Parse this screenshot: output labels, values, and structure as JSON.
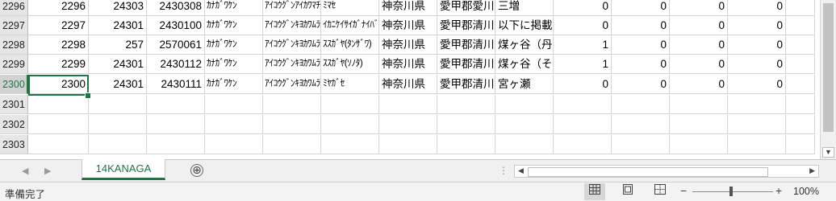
{
  "columns": [
    "",
    "",
    "",
    "",
    "",
    "",
    "",
    "",
    "",
    "",
    "",
    "",
    "",
    ""
  ],
  "rows": [
    {
      "row_num": "2296",
      "cells": [
        "2296",
        "24303",
        "2430308",
        "ｶﾅｶﾞﾜｹﾝ",
        "ｱｲｺｳｸﾞﾝｱｲｶﾜﾏﾁ",
        "ﾐﾏｾ",
        "神奈川県",
        "愛甲郡愛川町",
        "三増",
        "0",
        "0",
        "0",
        "0",
        ""
      ]
    },
    {
      "row_num": "2297",
      "cells": [
        "2297",
        "24301",
        "2430100",
        "ｶﾅｶﾞﾜｹﾝ",
        "ｱｲｺｳｸﾞﾝｷﾖｶﾜﾑﾗ",
        "ｲｶﾆｹｲｻｲｶﾞﾅｲﾊﾞｱｲ",
        "神奈川県",
        "愛甲郡清川村",
        "以下に掲載がない場合",
        "0",
        "0",
        "0",
        "0",
        ""
      ]
    },
    {
      "row_num": "2298",
      "cells": [
        "2298",
        "257",
        "2570061",
        "ｶﾅｶﾞﾜｹﾝ",
        "ｱｲｺｳｸﾞﾝｷﾖｶﾜﾑﾗ",
        "ｽｽｶﾞﾔ(ﾀﾝｻﾞﾜ)",
        "神奈川県",
        "愛甲郡清川村",
        "煤ヶ谷（丹沢）",
        "1",
        "0",
        "0",
        "0",
        ""
      ]
    },
    {
      "row_num": "2299",
      "cells": [
        "2299",
        "24301",
        "2430112",
        "ｶﾅｶﾞﾜｹﾝ",
        "ｱｲｺｳｸﾞﾝｷﾖｶﾜﾑﾗ",
        "ｽｽｶﾞﾔ(ｿﾉﾀ)",
        "神奈川県",
        "愛甲郡清川村",
        "煤ヶ谷（その他）",
        "1",
        "0",
        "0",
        "0",
        ""
      ]
    },
    {
      "row_num": "2300",
      "cells": [
        "2300",
        "24301",
        "2430111",
        "ｶﾅｶﾞﾜｹﾝ",
        "ｱｲｺｳｸﾞﾝｷﾖｶﾜﾑﾗ",
        "ﾐﾔｶﾞｾ",
        "神奈川県",
        "愛甲郡清川村",
        "宮ヶ瀬",
        "0",
        "0",
        "0",
        "0",
        ""
      ]
    },
    {
      "row_num": "2301",
      "cells": [
        "",
        "",
        "",
        "",
        "",
        "",
        "",
        "",
        "",
        "",
        "",
        "",
        "",
        ""
      ]
    },
    {
      "row_num": "2302",
      "cells": [
        "",
        "",
        "",
        "",
        "",
        "",
        "",
        "",
        "",
        "",
        "",
        "",
        "",
        ""
      ]
    },
    {
      "row_num": "2303",
      "cells": [
        "",
        "",
        "",
        "",
        "",
        "",
        "",
        "",
        "",
        "",
        "",
        "",
        "",
        ""
      ]
    }
  ],
  "sheet": {
    "tab_name": "14KANAGA",
    "add_symbol": "⊕",
    "nav_prev": "◀",
    "nav_next": "▶",
    "splitter": "⋮"
  },
  "status": {
    "text": "準備完了",
    "zoom": "100%",
    "zoom_minus": "−",
    "zoom_plus": "+"
  },
  "scroll": {
    "left": "◀",
    "right": "▶",
    "down": "▼"
  },
  "colors": {
    "accent": "#217346",
    "grid": "#d4d4d4",
    "header_bg": "#e6e6e6"
  }
}
